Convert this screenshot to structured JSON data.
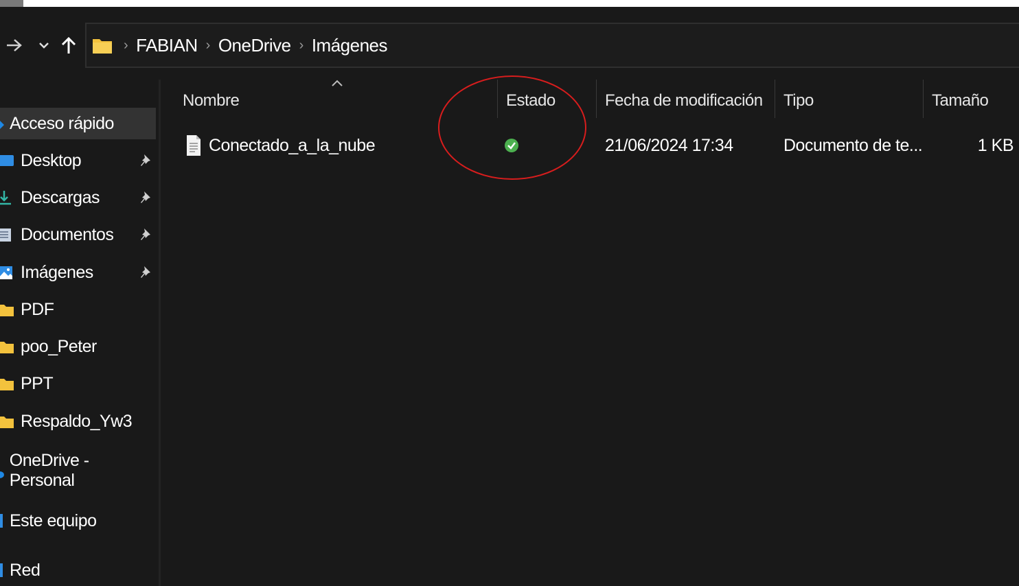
{
  "address": {
    "crumbs": [
      "FABIAN",
      "OneDrive",
      "Imágenes"
    ]
  },
  "sidebar": {
    "quick_access": "Acceso rápido",
    "items": [
      {
        "label": "Desktop",
        "pinned": true,
        "icon": "desktop-icon"
      },
      {
        "label": "Descargas",
        "pinned": true,
        "icon": "download-icon"
      },
      {
        "label": "Documentos",
        "pinned": true,
        "icon": "documents-icon"
      },
      {
        "label": "Imágenes",
        "pinned": true,
        "icon": "pictures-icon"
      },
      {
        "label": "PDF",
        "pinned": false,
        "icon": "folder-icon"
      },
      {
        "label": "poo_Peter",
        "pinned": false,
        "icon": "folder-icon"
      },
      {
        "label": "PPT",
        "pinned": false,
        "icon": "folder-icon"
      },
      {
        "label": "Respaldo_Yw3",
        "pinned": false,
        "icon": "folder-icon"
      }
    ],
    "onedrive": "OneDrive - Personal",
    "this_pc": "Este equipo",
    "network": "Red"
  },
  "columns": {
    "name": "Nombre",
    "status": "Estado",
    "modified": "Fecha de modificación",
    "type": "Tipo",
    "size": "Tamaño"
  },
  "files": [
    {
      "name": "Conectado_a_la_nube",
      "status": "synced-check-icon",
      "modified": "21/06/2024 17:34",
      "type": "Documento de te...",
      "size": "1 KB"
    }
  ],
  "colors": {
    "background": "#191919",
    "selected": "#333333",
    "status_ok": "#4cb04f",
    "annotation": "#d81d1d",
    "folder": "#f3c23d"
  }
}
